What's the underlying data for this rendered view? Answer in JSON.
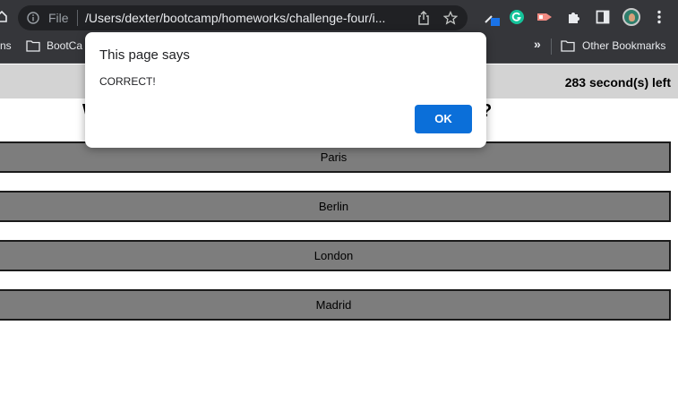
{
  "browser": {
    "scheme_label": "File",
    "url": "/Users/dexter/bootcamp/homeworks/challenge-four/i...",
    "bookmarks": {
      "left_cut": "ns",
      "folder1": "BootCa",
      "overflow": "»",
      "other": "Other Bookmarks"
    }
  },
  "page": {
    "timer": "283 second(s) left",
    "question_left": "W",
    "question_right": "?",
    "answers": [
      "Paris",
      "Berlin",
      "London",
      "Madrid"
    ]
  },
  "dialog": {
    "title": "This page says",
    "message": "CORRECT!",
    "ok_label": "OK"
  },
  "colors": {
    "chrome": "#35363a",
    "omnibox": "#202124",
    "topbar": "#d3d3d3",
    "answer_bg": "#7d7d7d",
    "ok_button": "#0b6fd9"
  }
}
